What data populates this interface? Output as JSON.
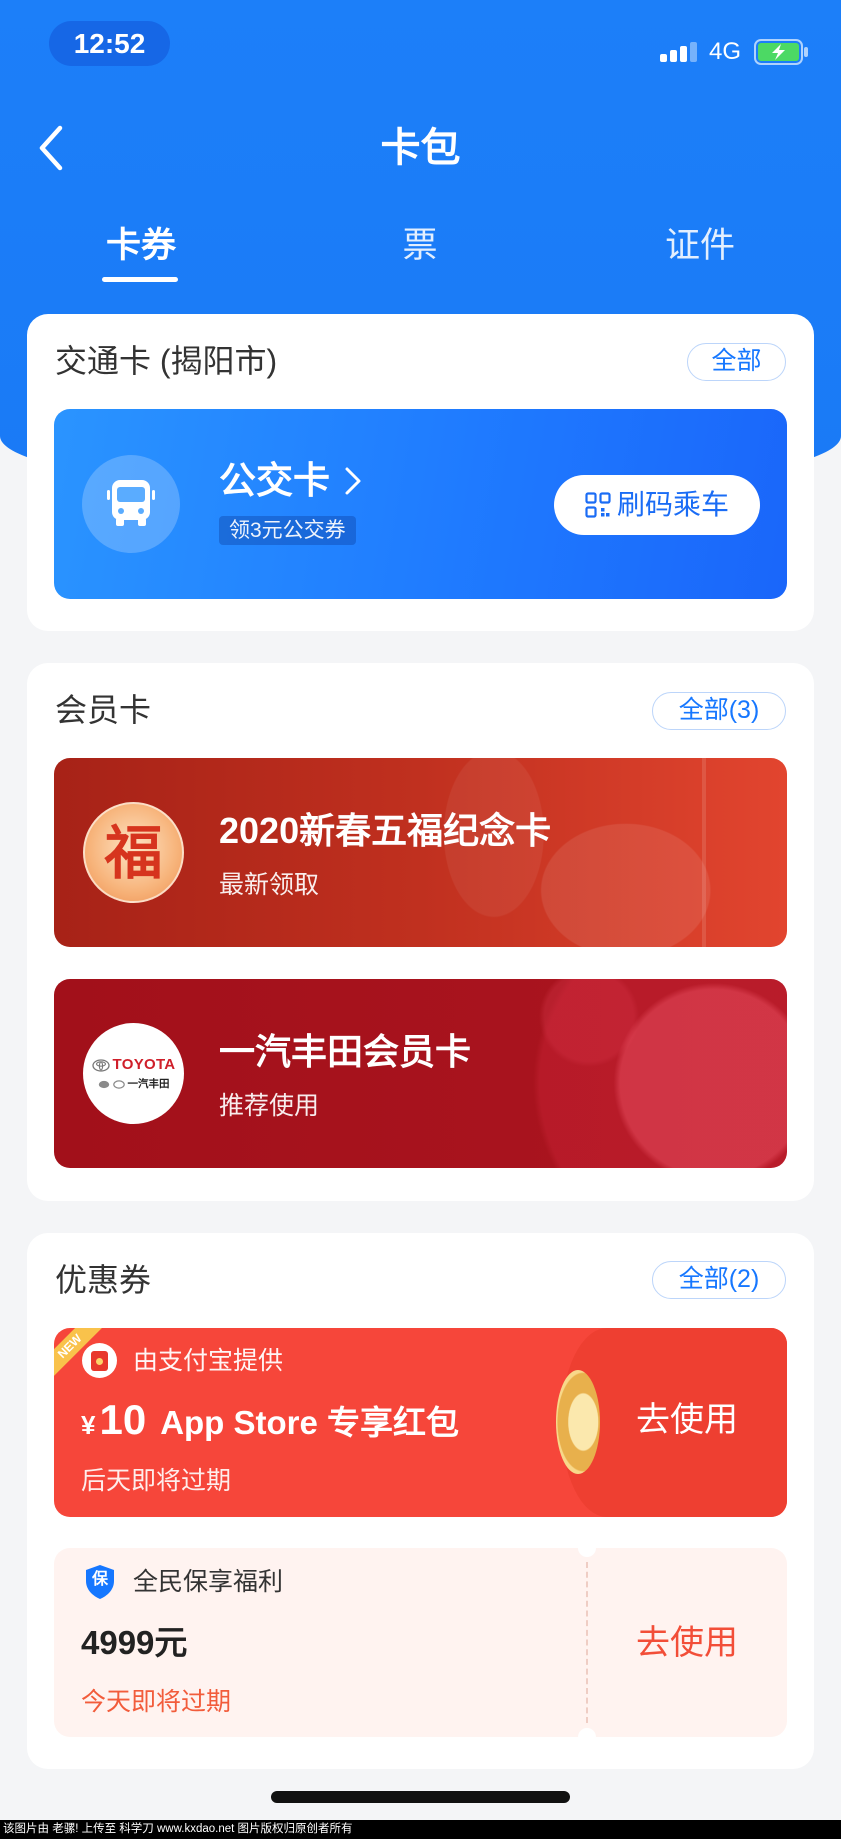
{
  "status_bar": {
    "time": "12:52",
    "network": "4G",
    "signal_icon": "signal-bars-icon",
    "battery_icon": "battery-charging-icon"
  },
  "header": {
    "title": "卡包",
    "back_icon": "chevron-left-icon"
  },
  "tabs": [
    {
      "label": "卡券"
    },
    {
      "label": "票"
    },
    {
      "label": "证件"
    }
  ],
  "active_tab_index": 0,
  "transit_section": {
    "title": "交通卡 (揭阳市)",
    "all_label": "全部",
    "card": {
      "icon": "bus-icon",
      "name": "公交卡",
      "promo_tag": "领3元公交券",
      "scan_button": "刷码乘车",
      "scan_icon": "qr-code-icon"
    }
  },
  "member_section": {
    "title": "会员卡",
    "all_label": "全部(3)",
    "cards": [
      {
        "logo_char": "福",
        "name": "2020新春五福纪念卡",
        "subtitle": "最新领取"
      },
      {
        "logo_brand": "TOYOTA",
        "logo_sub": "一汽丰田",
        "name": "一汽丰田会员卡",
        "subtitle": "推荐使用"
      }
    ]
  },
  "coupon_section": {
    "title": "优惠券",
    "all_label": "全部(2)",
    "coupons": [
      {
        "badge": "NEW",
        "provider_icon": "red-envelope-icon",
        "provider": "由支付宝提供",
        "currency": "¥",
        "amount": "10",
        "name": "App Store 专享红包",
        "expiry": "后天即将过期",
        "action": "去使用"
      },
      {
        "provider_icon": "shield-icon",
        "provider_icon_char": "保",
        "provider": "全民保享福利",
        "amount": "4999元",
        "expiry": "今天即将过期",
        "action": "去使用"
      }
    ]
  },
  "watermark": "该图片由 老骡! 上传至 科学刀 www.kxdao.net 图片版权归原创者所有",
  "colors": {
    "header_blue": "#1a7cf8",
    "transit_card_blue": "#1f7bff",
    "member_card_red": "#c0301f",
    "toyota_card_red": "#a5121b",
    "coupon_red": "#f6463a",
    "coupon_pink": "#fff3f0",
    "link_blue": "#1677ff",
    "expiry_red": "#f25c3b"
  }
}
